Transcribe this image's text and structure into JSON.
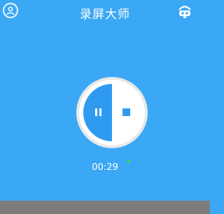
{
  "header": {
    "title": "录屏大师",
    "left_icon": "user-icon",
    "right_icon": "toolbox-icon"
  },
  "controls": {
    "pause_icon": "pause-icon",
    "stop_icon": "stop-icon"
  },
  "status": {
    "elapsed": "00:29",
    "recording_indicator": "green-dot"
  },
  "colors": {
    "background": "#3aa8f5",
    "accent": "#2f9bf0",
    "recording_dot": "#38d46a",
    "bottom_bar": "#7c7c7c"
  }
}
